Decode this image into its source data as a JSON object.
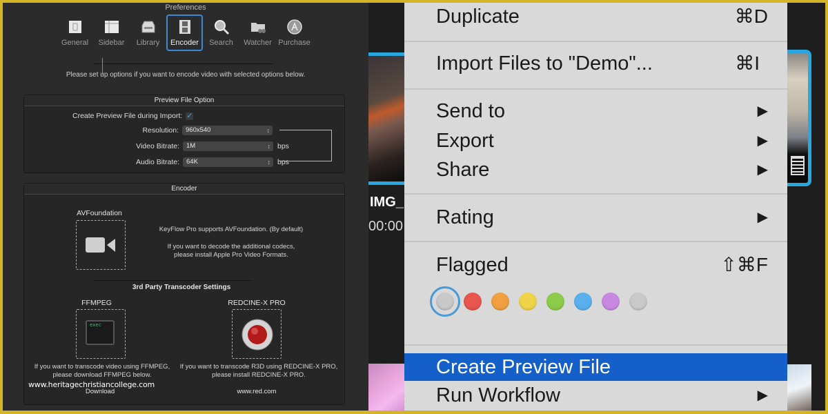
{
  "preferences": {
    "title": "Preferences",
    "toolbar": [
      {
        "label": "General",
        "icon": "general-icon",
        "active": false
      },
      {
        "label": "Sidebar",
        "icon": "sidebar-icon",
        "active": false
      },
      {
        "label": "Library",
        "icon": "library-icon",
        "active": false
      },
      {
        "label": "Encoder",
        "icon": "film-icon",
        "active": true
      },
      {
        "label": "Search",
        "icon": "magnifier-icon",
        "active": false
      },
      {
        "label": "Watcher",
        "icon": "folder-binoculars-icon",
        "active": false
      },
      {
        "label": "Purchase",
        "icon": "app-store-icon",
        "active": false
      }
    ],
    "intro": "Please set up options if you want to encode video with selected options below.",
    "preview_group": {
      "title": "Preview File Option",
      "create_label": "Create Preview File during Import:",
      "create_checked": true,
      "resolution_label": "Resolution:",
      "resolution_value": "960x540",
      "video_bitrate_label": "Video Bitrate:",
      "video_bitrate_value": "1M",
      "video_unit": "bps",
      "audio_bitrate_label": "Audio Bitrate:",
      "audio_bitrate_value": "64K",
      "audio_unit": "bps"
    },
    "encoder_group": {
      "title": "Encoder",
      "avf_title": "AVFoundation",
      "avf_text1": "KeyFlow Pro supports AVFoundation. (By default)",
      "avf_text2": "If you want to decode the additional codecs,",
      "avf_text3": "please install Apple Pro Video Formats.",
      "third_party_title": "3rd Party Transcoder Settings",
      "ffmpeg_title": "FFMPEG",
      "ffmpeg_icon_text": "exec",
      "ffmpeg_text1": "If you want to transcode video using FFMPEG,",
      "ffmpeg_text2": "please download FFMPEG below.",
      "ffmpeg_link": "Download",
      "red_title": "REDCINE-X PRO",
      "red_text1": "If you want to transcode R3D using REDCINE-X PRO,",
      "red_text2": "please install REDCINE-X PRO.",
      "red_link": "www.red.com"
    },
    "watermark": "www.heritagechristiancollege.com"
  },
  "context_menu": {
    "items": [
      {
        "label": "Duplicate",
        "shortcut": "⌘D"
      },
      {
        "label": "Import Files to \"Demo\"...",
        "shortcut": "⌘I"
      },
      {
        "label": "Send to",
        "submenu": true
      },
      {
        "label": "Export",
        "submenu": true
      },
      {
        "label": "Share",
        "submenu": true
      },
      {
        "label": "Rating",
        "submenu": true
      },
      {
        "label": "Flagged",
        "shortcut": "⇧⌘F"
      },
      {
        "label": "Create Preview File",
        "highlighted": true
      },
      {
        "label": "Run Workflow",
        "submenu": true
      }
    ],
    "submenu_arrow": "▶",
    "label_colors": [
      {
        "name": "none",
        "color": "#c8c8c8",
        "selected": true
      },
      {
        "name": "red",
        "color": "#e8564e"
      },
      {
        "name": "orange",
        "color": "#f0a040"
      },
      {
        "name": "yellow",
        "color": "#efd44a"
      },
      {
        "name": "green",
        "color": "#8ccc48"
      },
      {
        "name": "blue",
        "color": "#5ab0ec"
      },
      {
        "name": "purple",
        "color": "#c888e0"
      },
      {
        "name": "gray",
        "color": "#c9c9c9"
      }
    ],
    "highlight_color": "#1560c8"
  },
  "background": {
    "clip_name": "IMG_",
    "clip_time": "00:00"
  }
}
